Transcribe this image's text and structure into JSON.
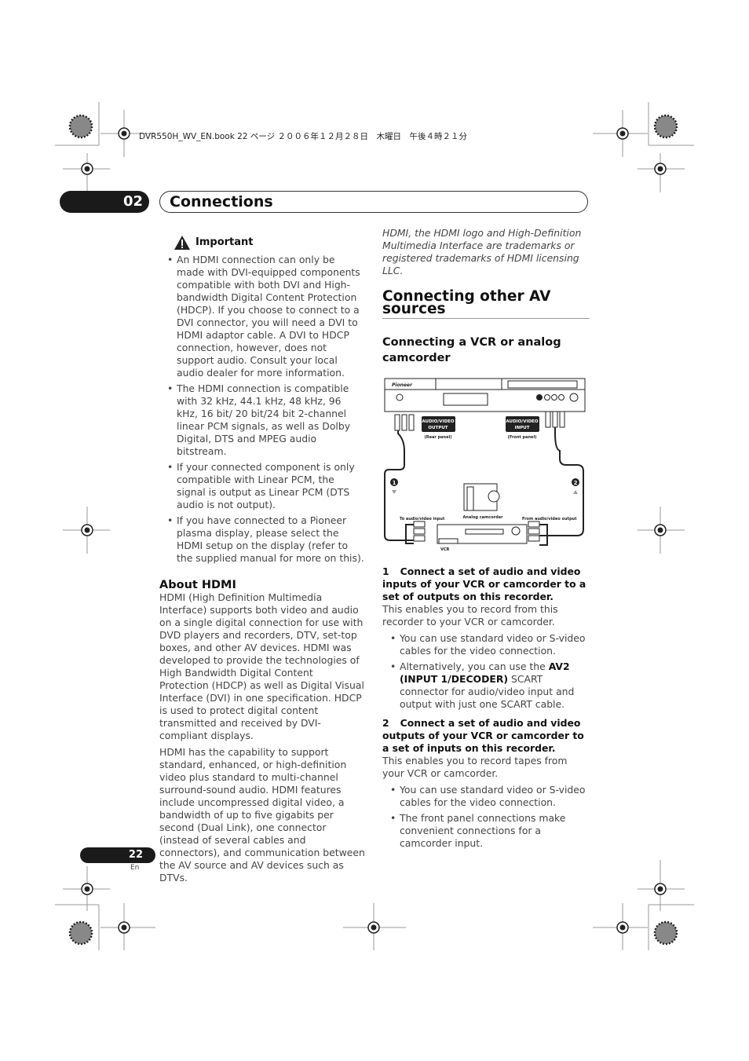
{
  "header": {
    "file_line": "DVR550H_WV_EN.book  22 ページ  ２００６年１２月２８日　木曜日　午後４時２１分"
  },
  "chapter": {
    "number": "02",
    "title": "Connections"
  },
  "left": {
    "important_title": "Important",
    "important_items": [
      "An HDMI connection can only be made with DVI-equipped components compatible with both DVI and High-bandwidth Digital Content Protection (HDCP). If you choose to connect to a DVI connector, you will need a DVI to HDMI adaptor cable. A DVI to HDCP connection, however, does not support audio. Consult your local audio dealer for more information.",
      "The HDMI connection is compatible with 32 kHz, 44.1 kHz, 48 kHz, 96 kHz, 16 bit/ 20 bit/24 bit 2-channel linear PCM signals, as well as Dolby Digital, DTS and MPEG audio bitstream.",
      "If your connected component is only compatible with Linear PCM, the signal is output as Linear PCM (DTS audio is not output).",
      "If you have connected to a Pioneer plasma display, please select the HDMI setup on the display (refer to the supplied manual for more on this)."
    ],
    "about_title": "About HDMI",
    "about_p1": "HDMI (High Definition Multimedia Interface) supports both video and audio on a single digital connection for use with DVD players and recorders, DTV, set-top boxes, and other AV devices. HDMI was developed to provide the technologies of High Bandwidth Digital Content Protection (HDCP) as well as Digital Visual Interface (DVI) in one specification. HDCP is used to protect digital content transmitted and received by DVI-compliant displays.",
    "about_p2": "HDMI has the capability to support standard, enhanced, or high-definition video plus standard to multi-channel surround-sound audio. HDMI features include uncompressed digital video, a bandwidth of up to five gigabits per second (Dual Link), one connector (instead of several cables and connectors), and communication between the AV source and AV devices such as DTVs."
  },
  "right": {
    "trademark": "HDMI, the HDMI logo and High-Definition Multimedia Interface are trademarks or registered trademarks of HDMI licensing LLC.",
    "section_title": "Connecting other AV sources",
    "subsection_title": "Connecting a VCR or analog camcorder",
    "diagram": {
      "output_label": "AUDIO/VIDEO OUTPUT",
      "output_sub": "(Rear panel)",
      "input_label": "AUDIO/VIDEO INPUT",
      "input_sub": "(Front panel)",
      "marker1": "1",
      "marker2": "2",
      "to_label": "To audio/video input",
      "camcorder_label": "Analog camcorder",
      "from_label": "From audio/video output",
      "vcr_label": "VCR"
    },
    "step1_num": "1",
    "step1_title": "Connect a set of audio and video inputs of your VCR or camcorder to a set of outputs on this recorder.",
    "step1_text": "This enables you to record from this recorder to your VCR or camcorder.",
    "step1_bullet1": "You can use standard video or S-video cables for the video connection.",
    "step1_bullet2_pre": "Alternatively, you can use the ",
    "step1_bullet2_bold": "AV2 (INPUT 1/DECODER)",
    "step1_bullet2_post": " SCART connector for audio/video input and output with just one SCART cable.",
    "step2_num": "2",
    "step2_title": "Connect a set of audio and video outputs of your VCR or camcorder to a set of inputs on this recorder.",
    "step2_text": "This enables you to record tapes from your VCR or camcorder.",
    "step2_bullet1": "You can use standard video or S-video cables for the video connection.",
    "step2_bullet2": "The front panel connections make convenient connections for a camcorder input."
  },
  "footer": {
    "page_number": "22",
    "language": "En"
  }
}
